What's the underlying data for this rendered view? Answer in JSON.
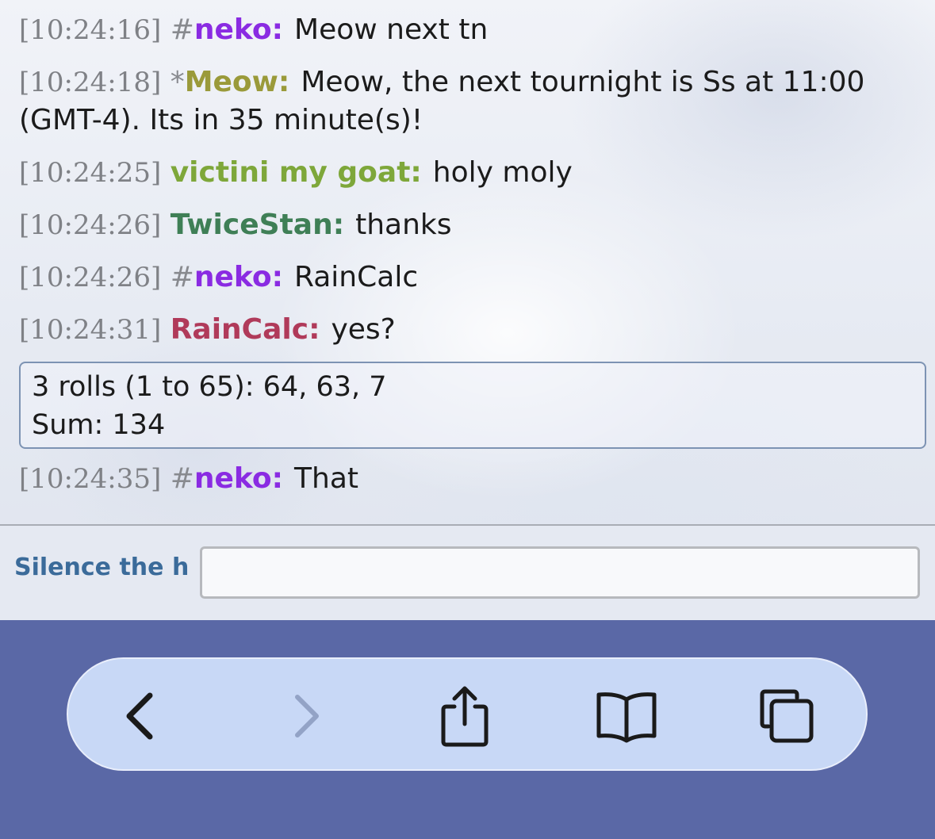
{
  "messages": [
    {
      "time": "[10:24:16]",
      "group": "#",
      "user": "neko:",
      "user_color": "#8a2be2",
      "text": "Meow next tn"
    },
    {
      "time": "[10:24:18]",
      "group": "*",
      "user": "Meow:",
      "user_color": "#9a9a3a",
      "text": "Meow, the next tournight is Ss at 11:00 (GMT-4). Its in 35 minute(s)!"
    },
    {
      "time": "[10:24:25]",
      "group": "",
      "user": "victini my goat:",
      "user_color": "#7ea73a",
      "text": "holy moly"
    },
    {
      "time": "[10:24:26]",
      "group": "",
      "user": "TwiceStan:",
      "user_color": "#3f7f56",
      "text": "thanks"
    },
    {
      "time": "[10:24:26]",
      "group": "#",
      "user": "neko:",
      "user_color": "#8a2be2",
      "text": "RainCalc"
    },
    {
      "time": "[10:24:31]",
      "group": "",
      "user": "RainCalc:",
      "user_color": "#b03a5a",
      "text": "yes?"
    }
  ],
  "roll": {
    "line1": "3 rolls (1 to 65): 64, 63, 7",
    "line2": "Sum: 134"
  },
  "last_message": {
    "time": "[10:24:35]",
    "group": "#",
    "user": "neko:",
    "user_color": "#8a2be2",
    "text": "That"
  },
  "input": {
    "label": "Silence the h",
    "value": "",
    "placeholder": ""
  },
  "toolbar": {
    "back_icon": "chevron-left-icon",
    "forward_icon": "chevron-right-icon",
    "share_icon": "share-icon",
    "bookmarks_icon": "book-icon",
    "tabs_icon": "tabs-icon",
    "colors": {
      "bar": "#5a68a6",
      "pill": "#c8d8f6",
      "icon": "#1a1a1a",
      "icon_disabled": "#93a3c6"
    }
  }
}
